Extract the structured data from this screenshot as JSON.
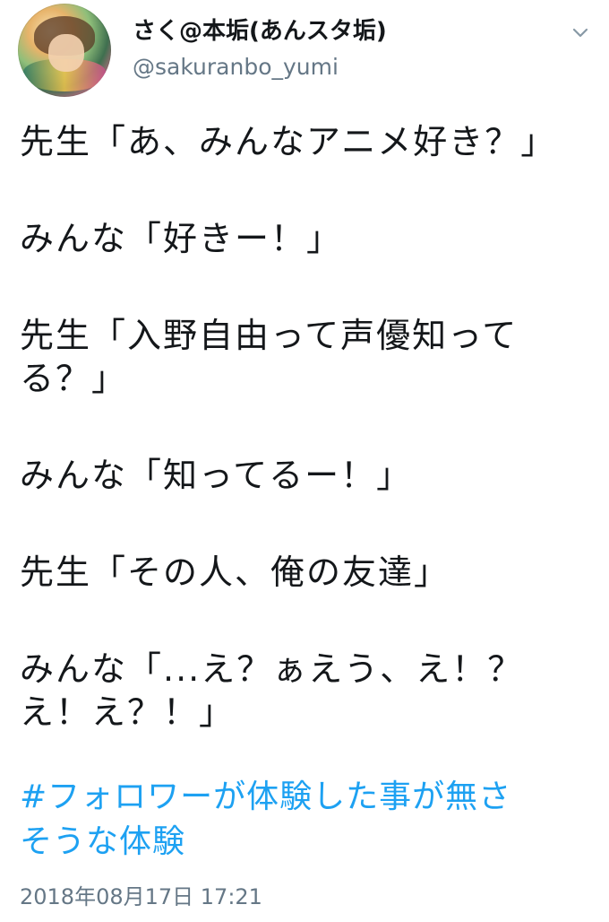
{
  "user": {
    "display_name": "さく@本垢(あんスタ垢)",
    "handle": "@sakuranbo_yumi"
  },
  "tweet": {
    "lines": [
      "先生「あ、みんなアニメ好き？」",
      "みんな「好きー！」",
      "先生「入野自由って声優知って",
      "る？」",
      "みんな「知ってるー！」",
      "先生「その人、俺の友達」",
      "みんな「...え？ぁえう、え！？",
      "え！え？！」"
    ],
    "hashtag_line1": "#フォロワーが体験した事が無さ",
    "hashtag_line2": "そうな体験",
    "timestamp": "2018年08月17日 17:21"
  },
  "icons": {
    "menu": "chevron-down-icon",
    "avatar": "user-avatar"
  },
  "colors": {
    "text": "#14171a",
    "secondary": "#657786",
    "link": "#1da1f2",
    "background": "#ffffff"
  }
}
